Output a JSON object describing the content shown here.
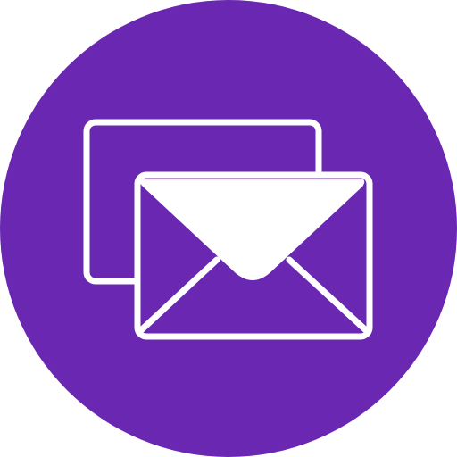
{
  "icon": {
    "name": "email-messages-icon",
    "colors": {
      "badge": "#6A28B2",
      "stroke": "#FFFFFF",
      "fill": "#FFFFFF"
    }
  }
}
